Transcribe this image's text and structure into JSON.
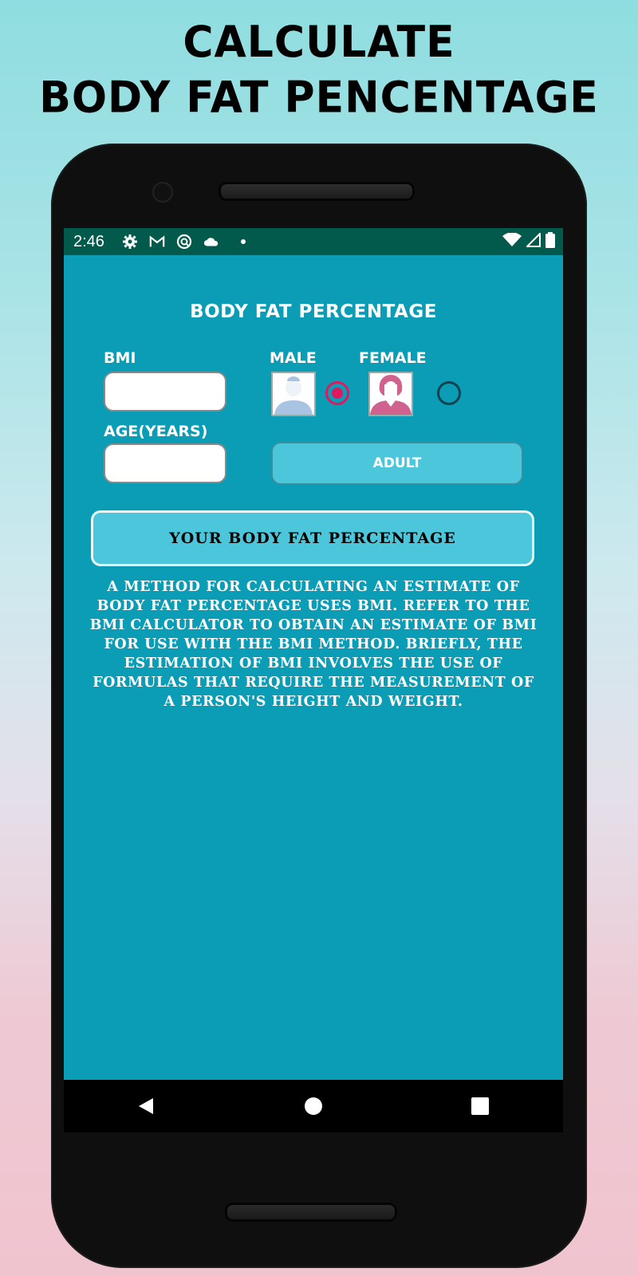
{
  "promo": {
    "title_line1": "Calculate",
    "title_line2": "Body Fat Pencentage"
  },
  "statusbar": {
    "time": "2:46",
    "left_icons": [
      "gear-icon",
      "gmail-icon",
      "at-sign-icon",
      "cloud-icon",
      "dot-icon"
    ],
    "right_icons": [
      "wifi-icon",
      "signal-icon",
      "battery-icon"
    ]
  },
  "app": {
    "heading": "Body Fat Percentage",
    "bmi_label": "BMI",
    "bmi_value": "",
    "age_label": "Age(Years)",
    "age_value": "",
    "male_label": "Male",
    "female_label": "Female",
    "gender_selected": "male",
    "adult_button": "Adult",
    "result_label": "Your Body Fat Percentage",
    "description": "A method for calculating an estimate of body fat percentage uses BMI. Refer to the BMI calculator to obtain an estimate of BMI for use with the BMI method. Briefly, the estimation of BMI involves the use of formulas that require the measurement of a person's height and weight."
  },
  "navbar": {
    "back": "back-icon",
    "home": "home-icon",
    "recents": "recents-icon"
  },
  "colors": {
    "screen_bg": "#0a9db5",
    "statusbar_bg": "#025a4c",
    "button_bg": "#4cc6da",
    "radio_selected": "#e0195f",
    "male_avatar": "#a9c4e2",
    "female_avatar": "#d0628f"
  }
}
